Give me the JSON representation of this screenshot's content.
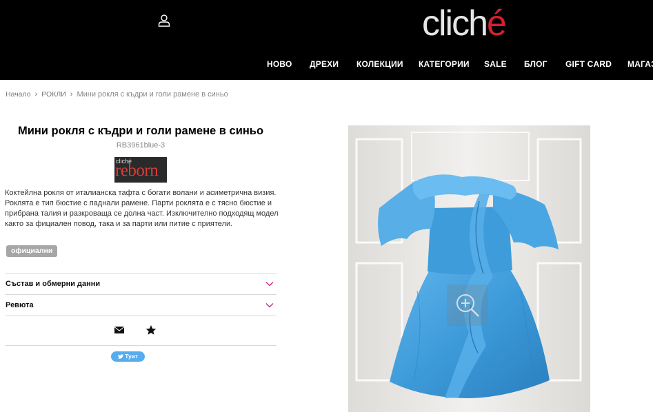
{
  "header": {
    "logo_text": "clich",
    "logo_accent_text": "é",
    "account_icon": "user-icon",
    "nav": [
      "НОВО",
      "ДРЕХИ",
      "КОЛЕКЦИИ",
      "КАТЕГОРИИ",
      "SALE",
      "БЛОГ",
      "GIFT CARD",
      "МАГАЗ"
    ]
  },
  "breadcrumb": {
    "home": "Начало",
    "category": "РОКЛИ",
    "current": "Мини рокля с къдри и голи рамене в синьо"
  },
  "product": {
    "title": "Мини рокля с къдри и голи рамене в синьо",
    "sku": "RB3961blue-3",
    "brand_small": "cliché",
    "brand_main": "reborn",
    "description": "Коктейлна рокля от италианска тафта с богати волани и асиметрична визия. Роклята е тип бюстие с паднали рамене. Парти роклята е с тясно бюстие и прибрана талия и разкроваща се долна част. Изключително подходящ модел както за фициален повод, така и за парти или питие с приятели.",
    "tag": "официални",
    "accordion": {
      "composition": "Състав и обмерни данни",
      "reviews": "Ревюта"
    },
    "share": {
      "email_icon": "envelope-icon",
      "favorite_icon": "star-icon",
      "tweet_label": "Туит"
    }
  },
  "colors": {
    "header_bg": "#000000",
    "logo_accent": "#d91f2e",
    "chevron": "#c0247a",
    "tag_bg": "#a6a6a6",
    "tweet_bg": "#55acee",
    "dress_blue": "#3d9ad9"
  }
}
